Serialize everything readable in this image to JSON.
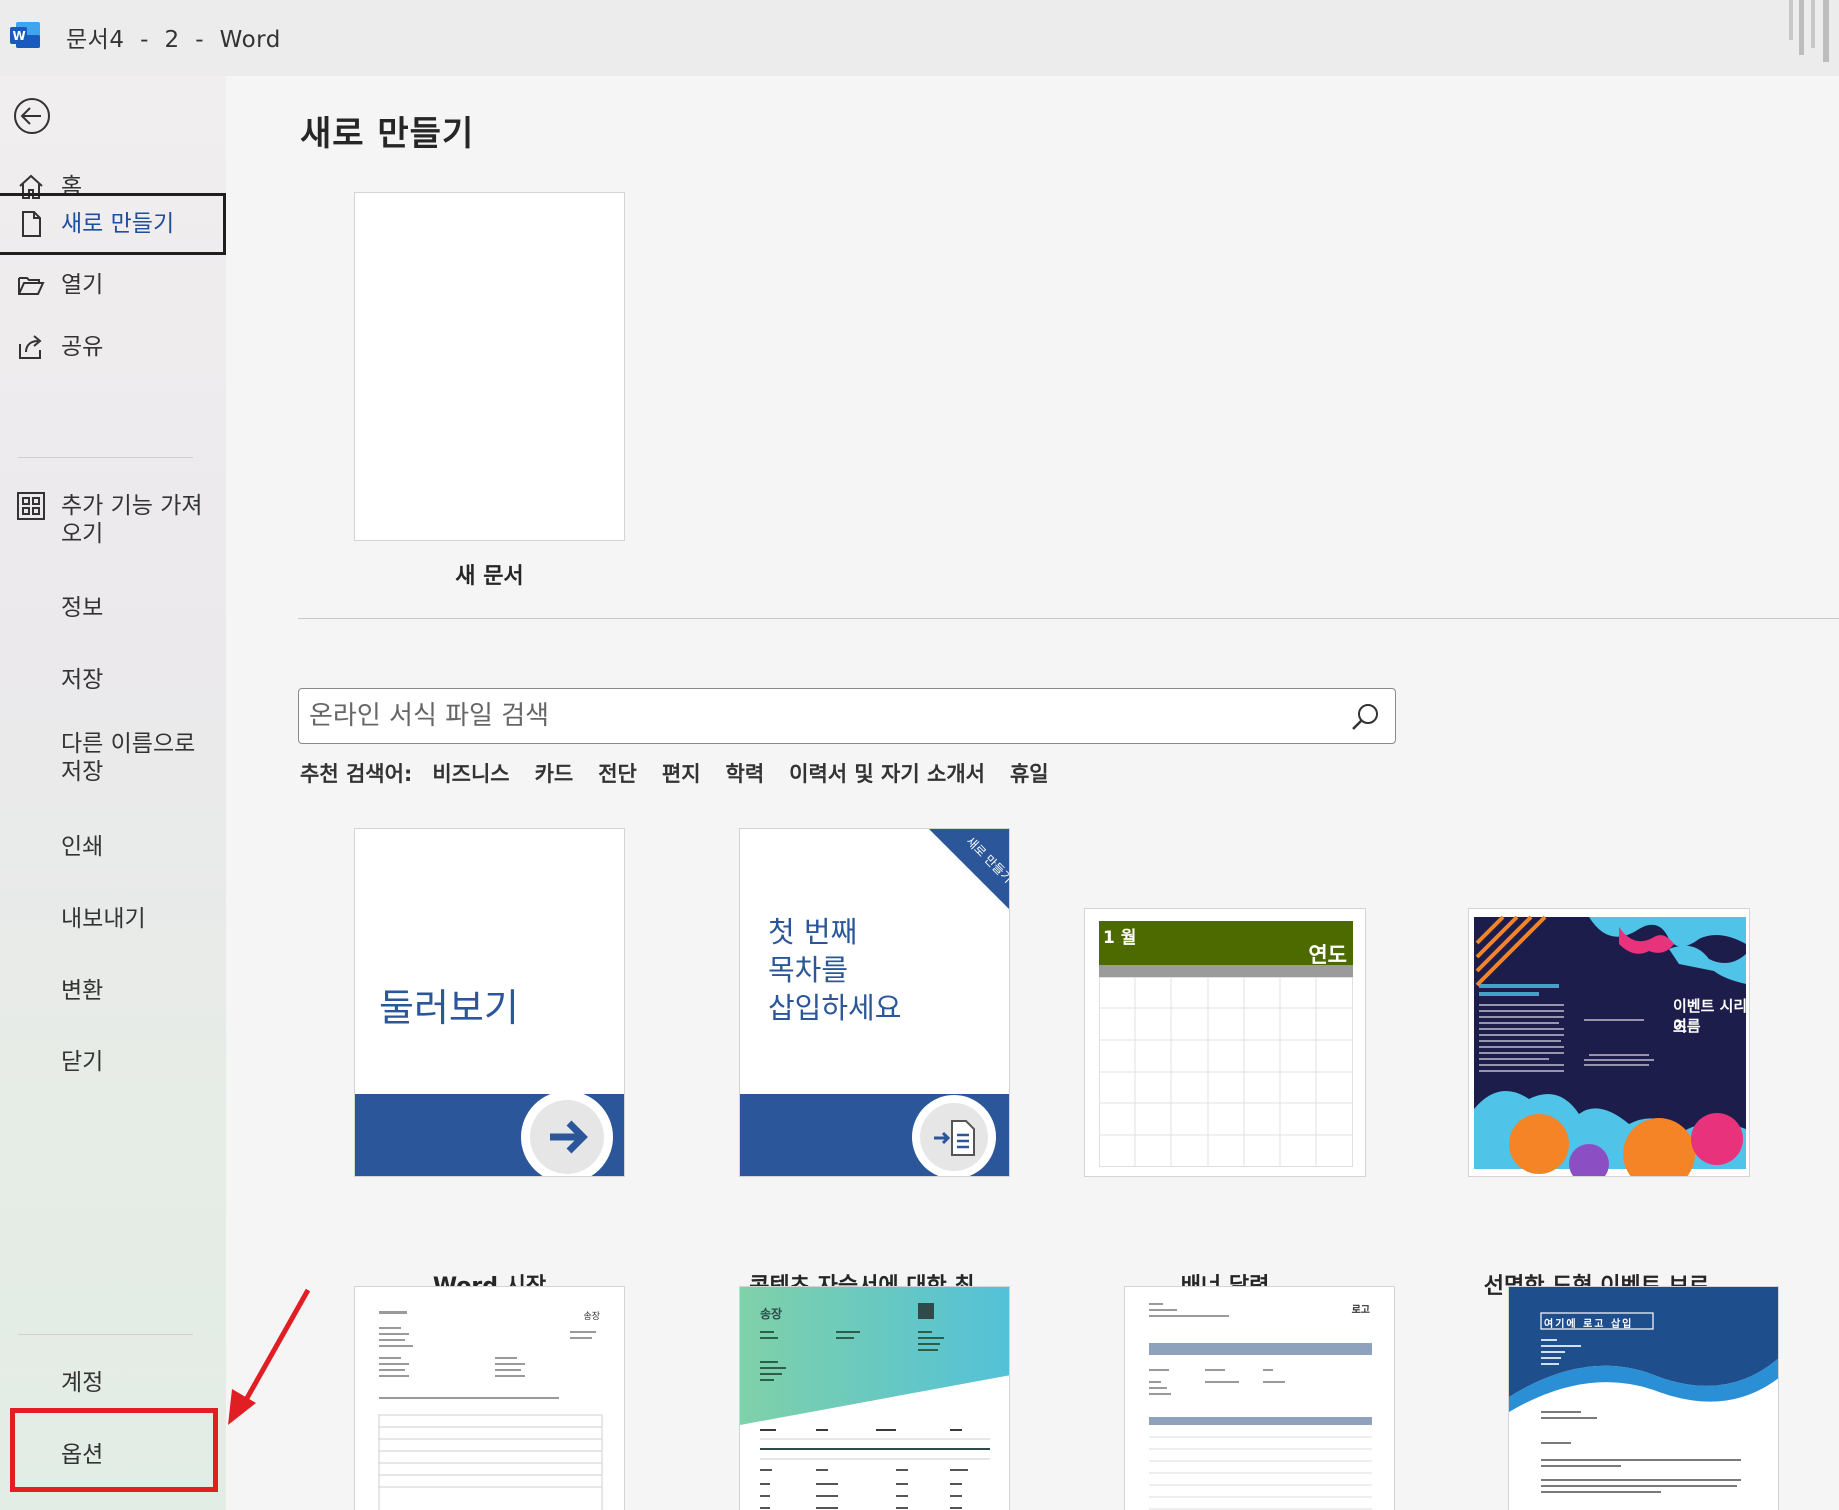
{
  "window": {
    "title": "문서4  -  2  -  Word",
    "app_icon": "word-logo-icon"
  },
  "sidebar": {
    "back_icon": "back-arrow-icon",
    "items": [
      {
        "label": "홈",
        "icon": "home-icon"
      },
      {
        "label": "새로 만들기",
        "icon": "new-document-icon",
        "active": true
      },
      {
        "label": "열기",
        "icon": "open-folder-icon"
      },
      {
        "label": "공유",
        "icon": "share-icon"
      },
      {
        "label": "추가 기능 가져",
        "label2": "오기",
        "icon": "addins-grid-icon"
      },
      {
        "label": "정보"
      },
      {
        "label": "저장"
      },
      {
        "label": "다른 이름으로",
        "label2": "저장"
      },
      {
        "label": "인쇄"
      },
      {
        "label": "내보내기"
      },
      {
        "label": "변환"
      },
      {
        "label": "닫기"
      }
    ],
    "bottom_items": [
      {
        "label": "계정"
      },
      {
        "label": "옵션",
        "highlighted": true
      }
    ]
  },
  "main": {
    "title": "새로 만들기",
    "blank_document_label": "새 문서",
    "search": {
      "placeholder": "온라인 서식 파일 검색",
      "value": ""
    },
    "suggested": {
      "label": "추천 검색어:",
      "terms": [
        "비즈니스",
        "카드",
        "전단",
        "편지",
        "학력",
        "이력서 및 자기 소개서",
        "휴일"
      ]
    },
    "templates": [
      {
        "name": "Word 시작",
        "thumb_text": "둘러보기"
      },
      {
        "name": "콘텐츠 자습서에 대한 최...",
        "thumb_text_lines": [
          "첫 번째",
          "목차를",
          "삽입하세요"
        ],
        "ribbon_text": "새로 만들기"
      },
      {
        "name": "배너 달력",
        "month": "1 월",
        "year": "연도"
      },
      {
        "name": "선명한 도형 이벤트 브로...",
        "event_title": "이벤트 시리즈",
        "event_subtitle": "이름"
      },
      {
        "name": "",
        "header": "송장"
      },
      {
        "name": "",
        "header": "송장"
      },
      {
        "name": "",
        "header": "로고"
      },
      {
        "name": "",
        "header": "여기에 로고 삽입"
      }
    ]
  },
  "colors": {
    "accent_blue": "#2b579a",
    "active_text": "#1e4e9e",
    "highlight_red": "#e21e25",
    "calendar_green": "#4d6a00",
    "brochure_navy": "#1c1d4a"
  }
}
